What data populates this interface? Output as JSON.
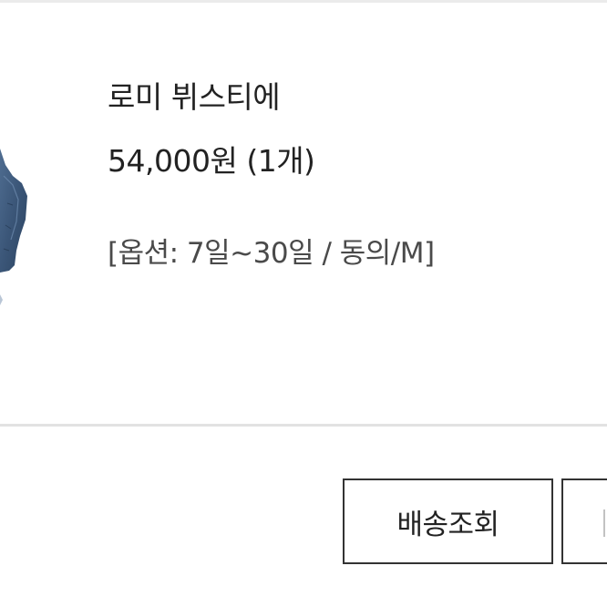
{
  "order_item": {
    "product_name": "로미 뷔스티에",
    "price_line": "54,000원 (1개)",
    "option_line": "[옵션: 7일~30일 / 동의/M]",
    "thumbnail": {
      "icon": "denim-bustier-image",
      "colors": [
        "#3b5678",
        "#2c4461",
        "#4f6d91"
      ]
    }
  },
  "actions": {
    "track_delivery_label": "배송조회",
    "next_action_label": ""
  },
  "colors": {
    "text": "#222222",
    "option_text": "#4a4a4a",
    "divider": "#e2e2e2",
    "button_border": "#333333"
  }
}
